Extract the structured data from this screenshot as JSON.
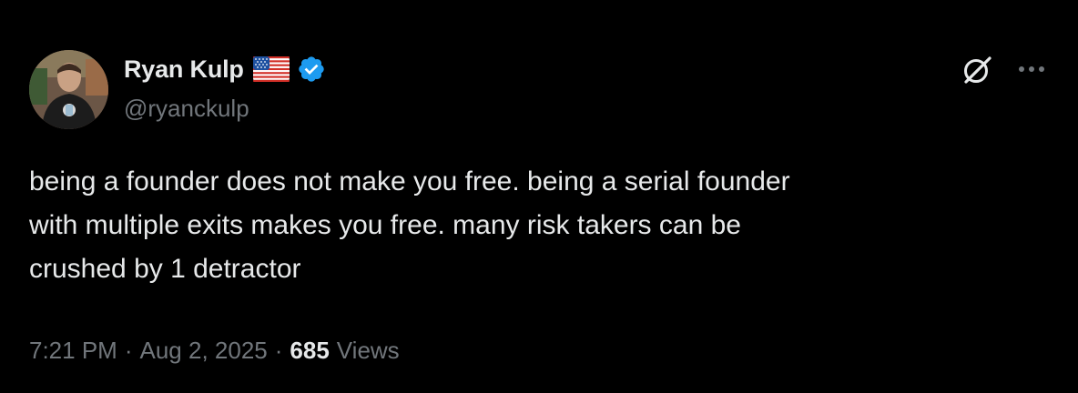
{
  "author": {
    "display_name": "Ryan Kulp",
    "handle": "@ryanckulp",
    "verified": true,
    "flag": "us-flag-emoji",
    "avatar": "profile-photo"
  },
  "post": {
    "text": "being a founder does not make you free. being a serial founder\nwith multiple exits makes you free. many risk takers can be\ncrushed by 1 detractor",
    "time": "7:21 PM",
    "date": "Aug 2, 2025",
    "separator": "·",
    "views_count": "685",
    "views_label": "Views"
  },
  "icons": {
    "grok": "grok-icon",
    "more": "more-options-icon",
    "verified_badge": "verified-badge-icon"
  },
  "colors": {
    "background": "#000000",
    "primary_text": "#e7e9ea",
    "secondary_text": "#71767b",
    "verified_blue": "#1d9bf0"
  }
}
